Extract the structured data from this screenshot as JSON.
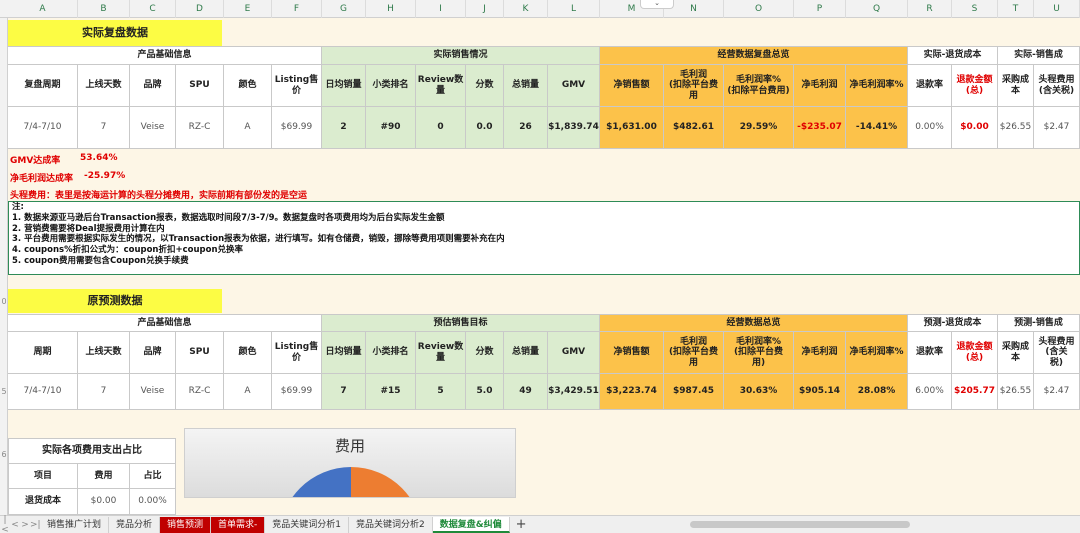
{
  "columns": [
    "A",
    "B",
    "C",
    "D",
    "E",
    "F",
    "G",
    "H",
    "I",
    "J",
    "K",
    "L",
    "M",
    "N",
    "O",
    "P",
    "Q",
    "R",
    "S",
    "T",
    "U"
  ],
  "row_numbers": [
    "0",
    "5",
    "6"
  ],
  "actual": {
    "title": "实际复盘数据",
    "group_basic": "产品基础信息",
    "group_sales": "实际销售情况",
    "group_ops": "经营数据复盘总览",
    "group_refund": "实际-退货成本",
    "group_sales_cost": "实际-销售成",
    "headers": [
      "复盘周期",
      "上线天数",
      "品牌",
      "SPU",
      "颜色",
      "Listing售价",
      "日均销量",
      "小类排名",
      "Review数量",
      "分数",
      "总销量",
      "GMV",
      "净销售额",
      "毛利润\n(扣除平台费用",
      "毛利润率%\n(扣除平台费用)",
      "净毛利润",
      "净毛利润率%",
      "退款率",
      "退款金额\n(总)",
      "采购成本",
      "头程费用\n(含关税)"
    ],
    "row": [
      "7/4-7/10",
      "7",
      "Veise",
      "RZ-C",
      "A",
      "$69.99",
      "2",
      "#90",
      "0",
      "0.0",
      "26",
      "$1,839.74",
      "$1,631.00",
      "$482.61",
      "29.59%",
      "-$235.07",
      "-14.41%",
      "0.00%",
      "$0.00",
      "$26.55",
      "$2.47"
    ],
    "gmv_rate_label": "GMV达成率",
    "gmv_rate_value": "53.64%",
    "net_profit_rate_label": "净毛利润达成率",
    "net_profit_rate_value": "-25.97%",
    "freight_note": "头程费用：表里是按海运计算的头程分摊费用，实际前期有部份发的是空运"
  },
  "notes": [
    "注:",
    "1. 数据来源亚马逊后台Transaction报表，数据选取时间段7/3-7/9。数据复盘时各项费用均为后台实际发生金额",
    "2. 营销费需要将Deal提报费用计算在内",
    "3. 平台费用需要根据实际发生的情况，以Transaction报表为依据，进行填写。如有仓储费，销毁，挪除等费用项则需要补充在内",
    "4. coupons%折扣公式为：coupon折扣+coupon兑换率",
    "5. coupon费用需要包含Coupon兑换手续费"
  ],
  "forecast": {
    "title": "原预测数据",
    "group_basic": "产品基础信息",
    "group_sales": "预估销售目标",
    "group_ops": "经营数据总览",
    "group_refund": "预测-退货成本",
    "group_sales_cost": "预测-销售成",
    "headers": [
      "周期",
      "上线天数",
      "品牌",
      "SPU",
      "颜色",
      "Listing售价",
      "日均销量",
      "小类排名",
      "Review数量",
      "分数",
      "总销量",
      "GMV",
      "净销售额",
      "毛利润\n(扣除平台费\n用",
      "毛利润率%\n(扣除平台费\n用)",
      "净毛利润",
      "净毛利润率%",
      "退款率",
      "退款金额\n(总)",
      "采购成本",
      "头程费用\n(含关\n税)"
    ],
    "row": [
      "7/4-7/10",
      "7",
      "Veise",
      "RZ-C",
      "A",
      "$69.99",
      "7",
      "#15",
      "5",
      "5.0",
      "49",
      "$3,429.51",
      "$3,223.74",
      "$987.45",
      "30.63%",
      "$905.14",
      "28.08%",
      "6.00%",
      "$205.77",
      "$26.55",
      "$2.47"
    ]
  },
  "expense_table": {
    "title": "实际各项费用支出占比",
    "headers": [
      "项目",
      "费用",
      "占比"
    ],
    "row": [
      "退货成本",
      "$0.00",
      "0.00%"
    ]
  },
  "chart_data": {
    "type": "pie",
    "title": "费用",
    "colors": [
      "#4472c4",
      "#ed7d31"
    ]
  },
  "tabs": [
    "销售推广计划",
    "竞品分析",
    "销售预测",
    "首单需求-",
    "竞品关键词分析1",
    "竞品关键词分析2",
    "数据复盘&纠偏"
  ],
  "active_tab": "数据复盘&纠偏",
  "red_tabs": [
    "销售预测",
    "首单需求-"
  ],
  "tab_nav": [
    "|<",
    "<",
    ">",
    ">|"
  ],
  "add_tab_label": "+",
  "scroll_up_label": "⌄"
}
